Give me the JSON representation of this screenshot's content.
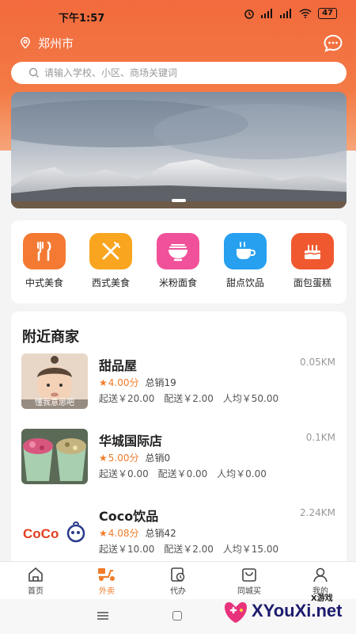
{
  "status_bar": {
    "time": "下午1:57",
    "battery": "47"
  },
  "header": {
    "city": "郑州市"
  },
  "search": {
    "placeholder": "请输入学校、小区、商场关键词"
  },
  "categories": [
    {
      "label": "中式美食",
      "icon": "chopsticks-icon",
      "color": "#f47a33"
    },
    {
      "label": "西式美食",
      "icon": "fork-knife-icon",
      "color": "#f9a51f"
    },
    {
      "label": "米粉面食",
      "icon": "noodle-bowl-icon",
      "color": "#f0519a"
    },
    {
      "label": "甜点饮品",
      "icon": "coffee-cup-icon",
      "color": "#27a0ef"
    },
    {
      "label": "面包蛋糕",
      "icon": "cake-icon",
      "color": "#f0592f"
    }
  ],
  "nearby": {
    "title": "附近商家",
    "shops": [
      {
        "name": "甜品屋",
        "distance": "0.05KM",
        "score": "4.00分",
        "sales": "总销19",
        "min_order": "起送￥20.00",
        "delivery_fee": "配送￥2.00",
        "per_person": "人均￥50.00",
        "image_caption": "懂我意思吧"
      },
      {
        "name": "华城国际店",
        "distance": "0.1KM",
        "score": "5.00分",
        "sales": "总销0",
        "min_order": "起送￥0.00",
        "delivery_fee": "配送￥0.00",
        "per_person": "人均￥0.00"
      },
      {
        "name": "Coco饮品",
        "distance": "2.24KM",
        "score": "4.08分",
        "sales": "总销42",
        "min_order": "起送￥10.00",
        "delivery_fee": "配送￥2.00",
        "per_person": "人均￥15.00",
        "logo_text": "CoCo"
      }
    ]
  },
  "tabbar": [
    {
      "label": "首页",
      "icon": "home-icon"
    },
    {
      "label": "外卖",
      "icon": "scooter-icon",
      "active": true
    },
    {
      "label": "代办",
      "icon": "clipboard-clock-icon"
    },
    {
      "label": "同城买",
      "icon": "shopping-bag-icon"
    },
    {
      "label": "我的",
      "icon": "user-icon"
    }
  ],
  "watermark": {
    "text": "XYouXi.net",
    "sub": "X游戏"
  },
  "colors": {
    "primary": "#f26a3d",
    "accent": "#f07c2a"
  }
}
